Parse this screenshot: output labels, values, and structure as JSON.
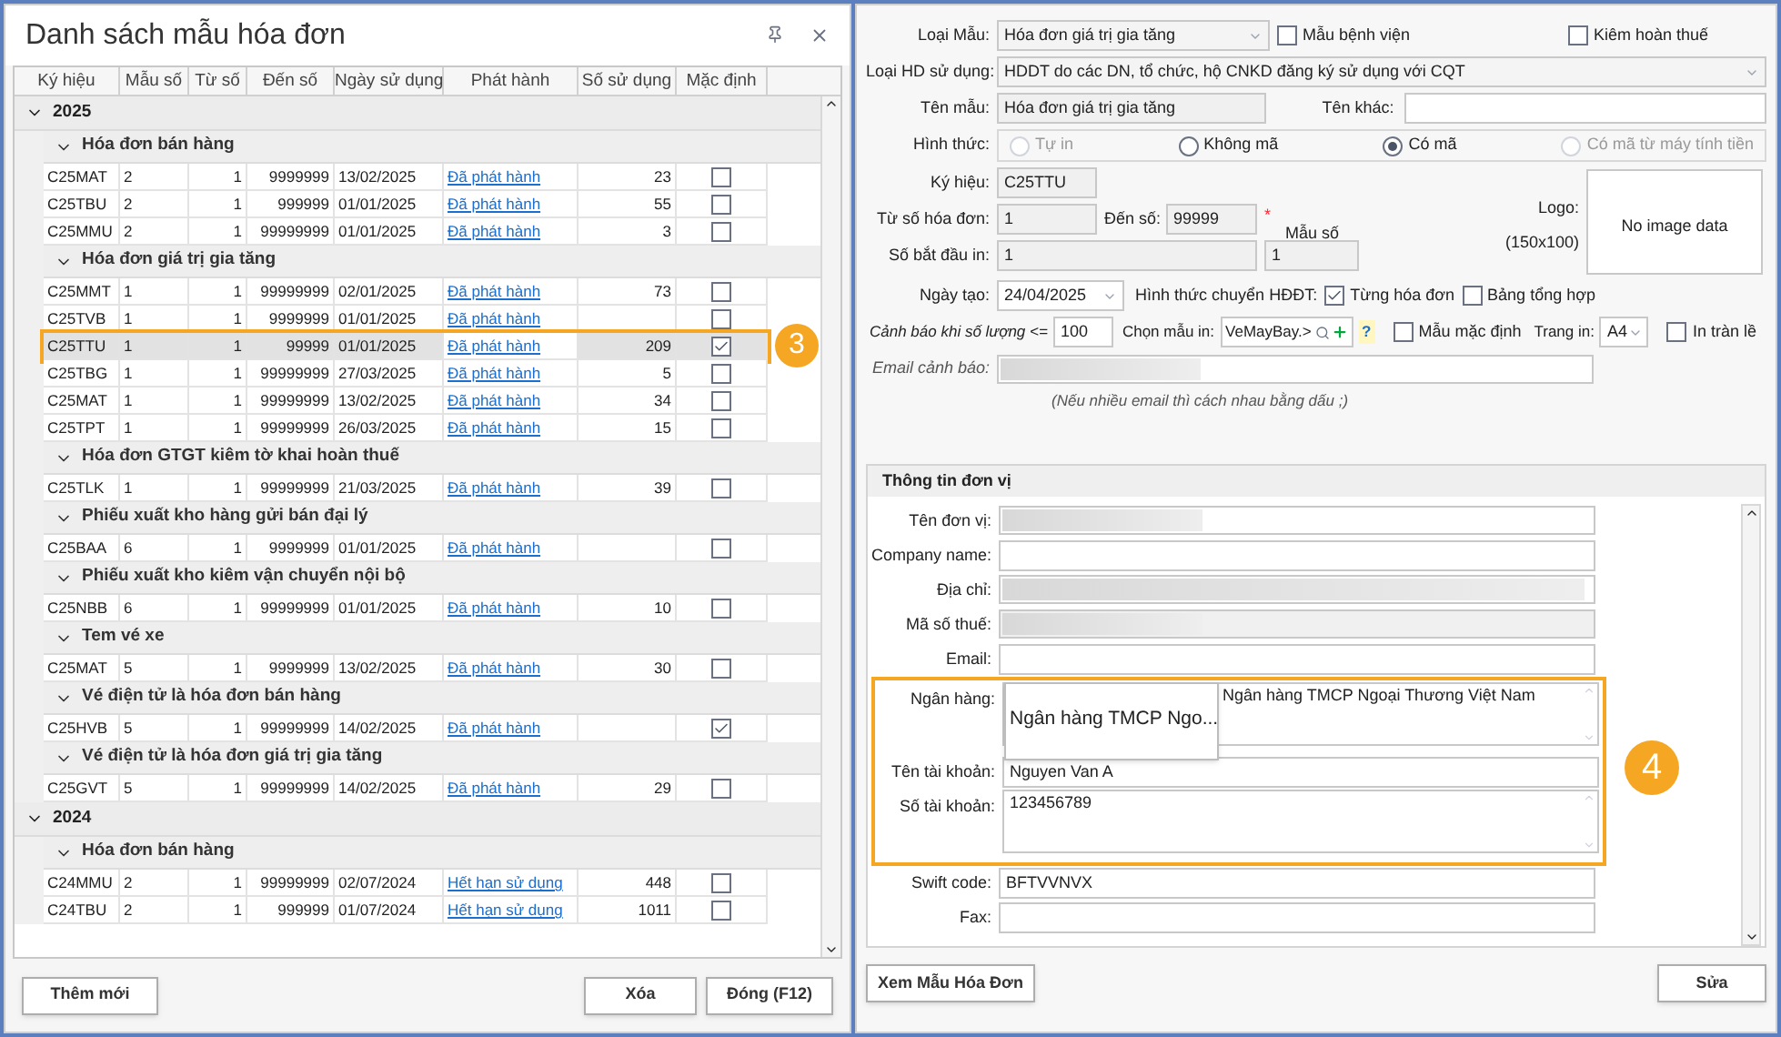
{
  "left_window": {
    "title": "Danh sách mẫu hóa đơn",
    "columns": [
      "Ký hiệu",
      "Mẫu số",
      "Từ số",
      "Đến số",
      "Ngày sử dụng",
      "Phát hành",
      "Số sử dụng",
      "Mặc định"
    ],
    "groups": [
      {
        "label": "2025",
        "expanded": true,
        "children": [
          {
            "label": "Hóa đơn bán hàng",
            "expanded": true,
            "rows": [
              {
                "cells": [
                  "C25MAT",
                  "2",
                  "1",
                  "9999999",
                  "13/02/2025"
                ],
                "status": "Đã phát hành",
                "count": "23",
                "default": false,
                "selected": false
              },
              {
                "cells": [
                  "C25TBU",
                  "2",
                  "1",
                  "999999",
                  "01/01/2025"
                ],
                "status": "Đã phát hành",
                "count": "55",
                "default": false,
                "selected": false
              },
              {
                "cells": [
                  "C25MMU",
                  "2",
                  "1",
                  "99999999",
                  "01/01/2025"
                ],
                "status": "Đã phát hành",
                "count": "3",
                "default": false,
                "selected": false
              }
            ]
          },
          {
            "label": "Hóa đơn giá trị gia tăng",
            "expanded": true,
            "rows": [
              {
                "cells": [
                  "C25MMT",
                  "1",
                  "1",
                  "99999999",
                  "02/01/2025"
                ],
                "status": "Đã phát hành",
                "count": "73",
                "default": false,
                "selected": false
              },
              {
                "cells": [
                  "C25TVB",
                  "1",
                  "1",
                  "9999999",
                  "01/01/2025"
                ],
                "status": "Đã phát hành",
                "default": false,
                "selected": false
              },
              {
                "cells": [
                  "C25TTU",
                  "1",
                  "1",
                  "99999",
                  "01/01/2025"
                ],
                "status": "Đã phát hành",
                "count": "209",
                "default": true,
                "selected": true,
                "callout": "3"
              },
              {
                "cells": [
                  "C25TBG",
                  "1",
                  "1",
                  "99999999",
                  "27/03/2025"
                ],
                "status": "Đã phát hành",
                "count": "5",
                "default": false,
                "selected": false
              },
              {
                "cells": [
                  "C25MAT",
                  "1",
                  "1",
                  "99999999",
                  "13/02/2025"
                ],
                "status": "Đã phát hành",
                "count": "34",
                "default": false,
                "selected": false
              },
              {
                "cells": [
                  "C25TPT",
                  "1",
                  "1",
                  "99999999",
                  "26/03/2025"
                ],
                "status": "Đã phát hành",
                "count": "15",
                "default": false,
                "selected": false
              }
            ]
          },
          {
            "label": "Hóa đơn GTGT kiêm tờ khai hoàn thuế",
            "expanded": true,
            "rows": [
              {
                "cells": [
                  "C25TLK",
                  "1",
                  "1",
                  "99999999",
                  "21/03/2025"
                ],
                "status": "Đã phát hành",
                "count": "39",
                "default": false,
                "selected": false
              }
            ]
          },
          {
            "label": "Phiếu xuất kho hàng gửi bán đại lý",
            "expanded": true,
            "rows": [
              {
                "cells": [
                  "C25BAA",
                  "6",
                  "1",
                  "9999999",
                  "01/01/2025"
                ],
                "status": "Đã phát hành",
                "default": false,
                "selected": false
              }
            ]
          },
          {
            "label": "Phiếu xuất kho kiêm vận chuyển nội bộ",
            "expanded": true,
            "rows": [
              {
                "cells": [
                  "C25NBB",
                  "6",
                  "1",
                  "99999999",
                  "01/01/2025"
                ],
                "status": "Đã phát hành",
                "count": "10",
                "default": false,
                "selected": false
              }
            ]
          },
          {
            "label": "Tem vé xe",
            "expanded": true,
            "rows": [
              {
                "cells": [
                  "C25MAT",
                  "5",
                  "1",
                  "9999999",
                  "13/02/2025"
                ],
                "status": "Đã phát hành",
                "count": "30",
                "default": false,
                "selected": false
              }
            ]
          },
          {
            "label": "Vé điện tử là hóa đơn bán hàng",
            "expanded": true,
            "rows": [
              {
                "cells": [
                  "C25HVB",
                  "5",
                  "1",
                  "99999999",
                  "14/02/2025"
                ],
                "status": "Đã phát hành",
                "default": true,
                "selected": false
              }
            ]
          },
          {
            "label": "Vé điện tử là hóa đơn giá trị gia tăng",
            "expanded": true,
            "rows": [
              {
                "cells": [
                  "C25GVT",
                  "5",
                  "1",
                  "99999999",
                  "14/02/2025"
                ],
                "status": "Đã phát hành",
                "count": "29",
                "default": false,
                "selected": false
              }
            ]
          }
        ]
      },
      {
        "label": "2024",
        "expanded": true,
        "children": [
          {
            "label": "Hóa đơn bán hàng",
            "expanded": true,
            "rows": [
              {
                "cells": [
                  "C24MMU",
                  "2",
                  "1",
                  "99999999",
                  "02/07/2024"
                ],
                "status": "Hết hạn sử dụng",
                "count": "448",
                "default": false,
                "selected": false
              },
              {
                "cells": [
                  "C24TBU",
                  "2",
                  "1",
                  "999999",
                  "01/07/2024"
                ],
                "status": "Hết hạn sử dụng",
                "count": "1011",
                "default": false,
                "selected": false
              }
            ]
          }
        ]
      }
    ],
    "buttons_left": [
      "Thêm mới"
    ],
    "buttons_right": [
      "Xóa",
      "Đóng (F12)"
    ]
  },
  "form": {
    "loai_mau": {
      "label": "Loại Mẫu:",
      "value": "Hóa đơn giá trị gia tăng"
    },
    "mau_benh_vien": {
      "label": "Mẫu bệnh viện",
      "checked": false
    },
    "kiem_hoan_thue": {
      "label": "Kiêm hoàn thuế",
      "checked": false
    },
    "loai_hd": {
      "label": "Loại HD sử dụng:",
      "value": "HDDT do các DN, tổ chức, hộ CNKD đăng ký sử dụng với CQT"
    },
    "ten_mau": {
      "label": "Tên mẫu:",
      "value": "Hóa đơn giá trị gia tăng"
    },
    "ten_khac": {
      "label": "Tên khác:"
    },
    "hinh_thuc": {
      "label": "Hình thức:",
      "options": [
        {
          "label": "Tự in",
          "selected": false,
          "disabled": true
        },
        {
          "label": "Không mã",
          "selected": false,
          "disabled": false
        },
        {
          "label": "Có mã",
          "selected": true,
          "disabled": false
        },
        {
          "label": "Có mã từ máy tính tiền",
          "selected": false,
          "disabled": true
        }
      ]
    },
    "ky_hieu": {
      "label": "Ký hiệu:",
      "value": "C25TTU"
    },
    "tu_so": {
      "label": "Từ số hóa đơn:",
      "value": "1"
    },
    "den_so": {
      "label": "Đến số:",
      "value": "99999",
      "mark": "*"
    },
    "mau_so": {
      "label": "Mẫu số",
      "value": "1"
    },
    "so_bat_dau": {
      "label": "Số bắt đầu  in:",
      "value": "1"
    },
    "logo": {
      "label": "Logo:",
      "size": "(150x100)",
      "empty_text": "No image data"
    },
    "ngay_tao": {
      "label": "Ngày tạo:",
      "value": "24/04/2025"
    },
    "hinh_thuc_chuyen": {
      "label": "Hình thức chuyển HĐĐT:",
      "options": [
        {
          "label": "Từng hóa đơn",
          "checked": true
        },
        {
          "label": "Bảng tổng hợp",
          "checked": false
        }
      ]
    },
    "canh_bao": {
      "label": "Cảnh báo khi số lượng <=",
      "value": "100"
    },
    "chon_mau_in": {
      "label": "Chọn mẫu in:",
      "value": "VeMayBay.>",
      "help": "?"
    },
    "mau_mac_dinh": {
      "label": "Mẫu mặc định",
      "checked": false
    },
    "trang_in": {
      "label": "Trang in:",
      "value": "A4"
    },
    "in_tran_le": {
      "label": "In tràn lề",
      "checked": false
    },
    "email_canh_bao": {
      "label": "Email cảnh báo:",
      "hint": "(Nếu nhiều email thì cách nhau bằng dấu ;)"
    }
  },
  "don_vi": {
    "title": "Thông tin đơn vị",
    "field_groups": [
      {
        "fields": [
          {
            "kind": "redacted",
            "label": "Tên đơn vị:"
          },
          {
            "kind": "text",
            "label": "Company name:"
          },
          {
            "kind": "redacted",
            "label": "Địa chỉ:"
          },
          {
            "kind": "redacted_disabled",
            "label": "Mã số thuế:"
          },
          {
            "kind": "text",
            "label": "Email:"
          }
        ]
      },
      {
        "callout": "4",
        "fields": [
          {
            "kind": "bank",
            "label": "Ngân hàng:",
            "value": "Ngân hàng TMCP Ngoại Thương Việt Nam",
            "dropdown": "Ngân hàng TMCP Ngo..."
          },
          {
            "kind": "text",
            "label": "Tên tài khoản:",
            "value": "Nguyen Van A"
          },
          {
            "kind": "memo",
            "label": "Số tài khoản:",
            "value": "123456789"
          }
        ]
      },
      {
        "fields": [
          {
            "kind": "text",
            "label": "Swift code:",
            "value": "BFTVVNVX"
          },
          {
            "kind": "text",
            "label": "Fax:"
          }
        ]
      }
    ]
  },
  "buttons_bottom": [
    "Xem Mẫu Hóa Đơn",
    "Sửa"
  ]
}
